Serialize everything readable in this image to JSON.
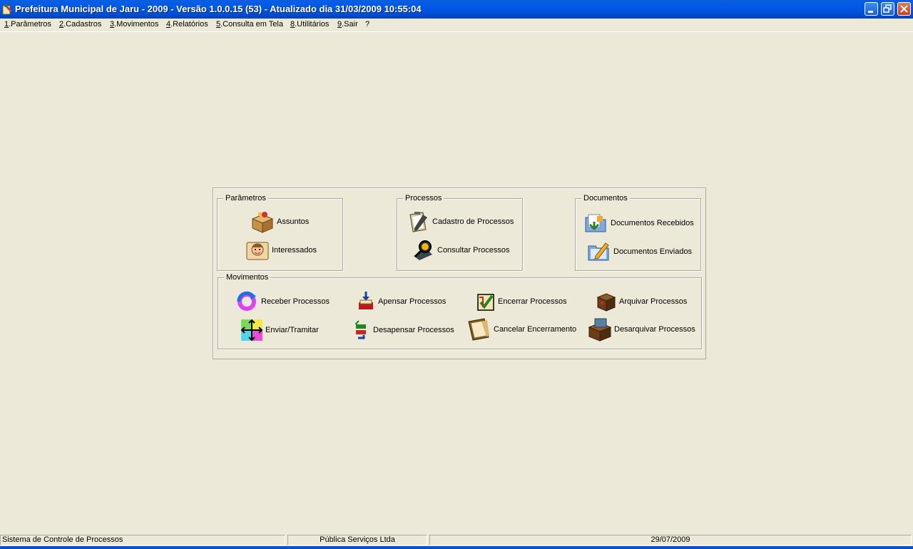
{
  "window": {
    "title": "Prefeitura Municipal de Jaru - 2009 - Versão 1.0.0.15 (53) - Atualizado dia 31/03/2009 10:55:04"
  },
  "menu": [
    {
      "key": "1",
      "label": ".Parâmetros"
    },
    {
      "key": "2",
      "label": ".Cadastros"
    },
    {
      "key": "3",
      "label": ".Movimentos"
    },
    {
      "key": "4",
      "label": ".Relatórios"
    },
    {
      "key": "5",
      "label": ".Consulta em Tela"
    },
    {
      "key": "8",
      "label": ".Utilitários"
    },
    {
      "key": "9",
      "label": ".Sair"
    },
    {
      "key": "",
      "label": "?"
    }
  ],
  "groups": {
    "parametros": {
      "title": "Parâmetros",
      "items": [
        "Assuntos",
        "Interessados"
      ]
    },
    "processos": {
      "title": "Processos",
      "items": [
        "Cadastro de Processos",
        "Consultar Processos"
      ]
    },
    "documentos": {
      "title": "Documentos",
      "items": [
        "Documentos Recebidos",
        "Documentos Enviados"
      ]
    },
    "movimentos": {
      "title": "Movimentos",
      "items": [
        "Receber Processos",
        "Apensar Processos",
        "Encerrar Processos",
        "Arquivar Processos",
        "Enviar/Tramitar",
        "Desapensar Processos",
        "Cancelar Encerramento",
        "Desarquivar Processos"
      ]
    }
  },
  "status": {
    "system": "Sistema de Controle de Processos",
    "company": "Pública Serviços Ltda",
    "date": "29/07/2009"
  },
  "icons": {
    "assuntos": "box-icon",
    "interessados": "person-icon",
    "cadastro": "clipboard-icon",
    "consultar": "magnifier-icon",
    "recebidos": "folder-in-icon",
    "enviados": "folder-edit-icon",
    "receber": "refresh-icon",
    "apensar": "attach-icon",
    "encerrar": "check-icon",
    "arquivar": "archive-box-icon",
    "enviar": "move-arrows-icon",
    "desapensar": "detach-icon",
    "cancelar": "folder-cancel-icon",
    "desarquivar": "unarchive-icon"
  }
}
